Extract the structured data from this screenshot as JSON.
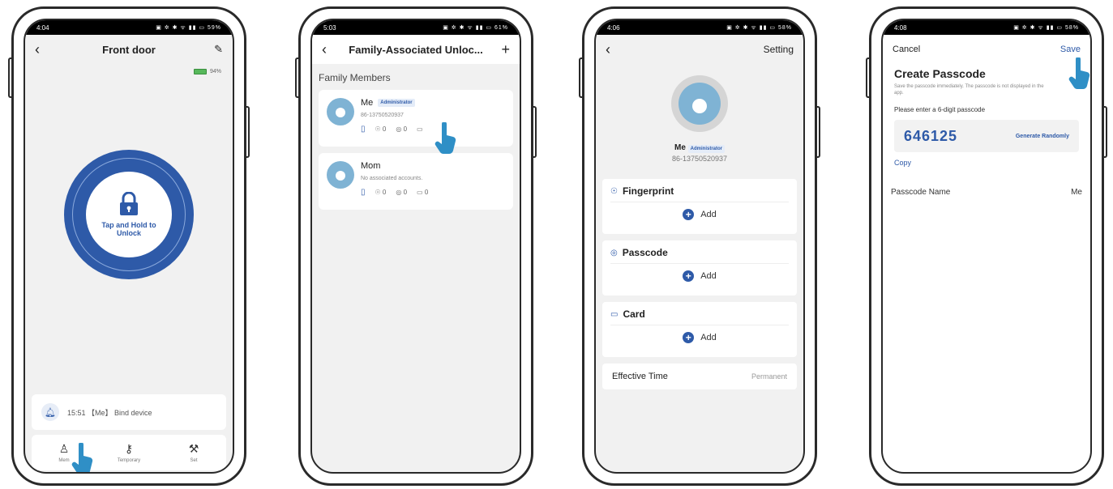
{
  "colors": {
    "accent": "#2e5aa8",
    "hand": "#2f8fc6"
  },
  "phone1": {
    "status_time": "4:04",
    "status_right": "59%",
    "title": "Front door",
    "back_icon": "chevron-left-icon",
    "edit_icon": "edit-pencil-icon",
    "battery": "94%",
    "unlock_label": "Tap and Hold to Unlock",
    "notice": "15:51 【Me】 Bind device",
    "tabs": [
      {
        "label": "Mem"
      },
      {
        "label": "Temporary"
      },
      {
        "label": "Set"
      }
    ]
  },
  "phone2": {
    "status_time": "5:03",
    "status_right": "61%",
    "title": "Family-Associated Unloc...",
    "section": "Family Members",
    "members": [
      {
        "name": "Me",
        "badge": "Administrator",
        "sub": "86-13750520937",
        "fp": "0",
        "pc": "0",
        "card": ""
      },
      {
        "name": "Mom",
        "badge": "",
        "sub": "No associated accounts.",
        "fp": "0",
        "pc": "0",
        "card": "0"
      }
    ]
  },
  "phone3": {
    "status_time": "4:06",
    "status_right": "58%",
    "setting": "Setting",
    "name": "Me",
    "badge": "Administrator",
    "phone": "86-13750520937",
    "sections": [
      {
        "title": "Fingerprint",
        "add": "Add"
      },
      {
        "title": "Passcode",
        "add": "Add"
      },
      {
        "title": "Card",
        "add": "Add"
      }
    ],
    "effective_label": "Effective Time",
    "effective_value": "Permanent"
  },
  "phone4": {
    "status_time": "4:08",
    "status_right": "58%",
    "cancel": "Cancel",
    "save": "Save",
    "title": "Create Passcode",
    "desc": "Save the passcode immediately. The passcode is not displayed in the app.",
    "label": "Please enter a 6-digit passcode",
    "code": "646125",
    "generate": "Generate Randomly",
    "copy": "Copy",
    "name_label": "Passcode Name",
    "name_value": "Me"
  }
}
